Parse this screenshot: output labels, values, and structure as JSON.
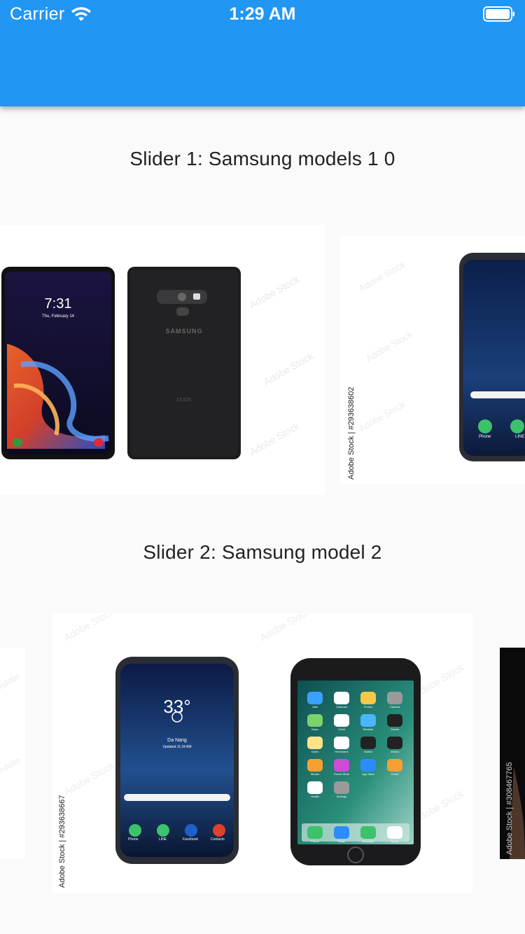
{
  "status_bar": {
    "carrier": "Carrier",
    "time": "1:29 AM"
  },
  "sliders": [
    {
      "title": "Slider 1: Samsung models 1 0",
      "slides": [
        {
          "image": "samsung-note9-front-back-photo",
          "lock_time": "7:31",
          "lock_date": "Thu, February 14",
          "back_brand": "SAMSUNG",
          "back_duos": "DUOS"
        },
        {
          "image": "samsung-s8-photo",
          "watermark": "Adobe Stock | #293638602",
          "dock_labels": [
            "Phone",
            "LINE"
          ]
        }
      ]
    },
    {
      "title": "Slider 2: Samsung model 2",
      "slides": [
        {
          "image": "partial-white-slide"
        },
        {
          "image": "samsung-s8-and-iphone-photo",
          "watermark": "Adobe Stock | #293638667",
          "weather_temp": "33°",
          "weather_city": "Da Nang",
          "weather_updated": "Updated 11:34 AM",
          "samsung_dock": [
            "Phone",
            "LINE",
            "Facebook",
            "Contacts"
          ],
          "iphone_apps": [
            "Mail",
            "Calendar",
            "Photos",
            "Camera",
            "Maps",
            "Clock",
            "Weather",
            "Stocks",
            "Notes",
            "Reminders",
            "Videos",
            "Videos",
            "iBooks",
            "iTunes Store",
            "App Store",
            "Home",
            "Health",
            "Settings"
          ],
          "iphone_dock": [
            "Phone",
            "Safari",
            "Messages",
            "Music"
          ]
        },
        {
          "image": "dark-phone-photo",
          "watermark": "Adobe Stock | #308467765"
        }
      ]
    }
  ],
  "colors": {
    "app_bar": "#2196f3",
    "background": "#fafafa"
  }
}
